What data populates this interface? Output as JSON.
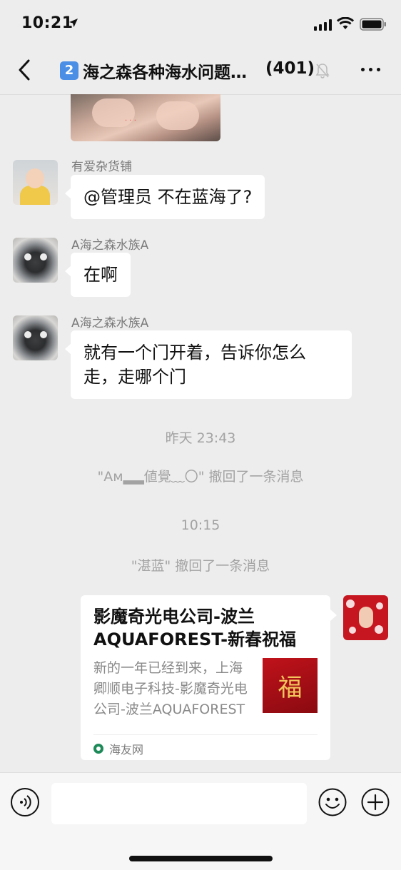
{
  "status_bar": {
    "time": "10:21"
  },
  "header": {
    "badge": "2",
    "title": "海之森各种海水问题交流群",
    "count": "(401)"
  },
  "messages": [
    {
      "sender": "有爱杂货铺",
      "text": "@管理员 不在蓝海了?"
    },
    {
      "sender": "A海之森水族A",
      "text": "在啊"
    },
    {
      "sender": "A海之森水族A",
      "text": "就有一个门开着，告诉你怎么走，走哪个门"
    }
  ],
  "system": {
    "time1": "昨天 23:43",
    "recall1": "\"Aм▂▂値覺﹏〇\" 撤回了一条消息",
    "time2": "10:15",
    "recall2": "\"湛蓝\" 撤回了一条消息"
  },
  "share_card": {
    "title": "影魔奇光电公司-波兰AQUAFOREST-新春祝福",
    "description": "新的一年已经到来，上海卿顺电子科技-影魔奇光电公司-波兰AQUAFOREST",
    "thumb_text": "福",
    "source": "海友网"
  },
  "input": {
    "placeholder": ""
  },
  "colors": {
    "background": "#ededed",
    "bubble": "#ffffff",
    "badge": "#4a8ee6",
    "source_icon": "#1e8a5a"
  }
}
